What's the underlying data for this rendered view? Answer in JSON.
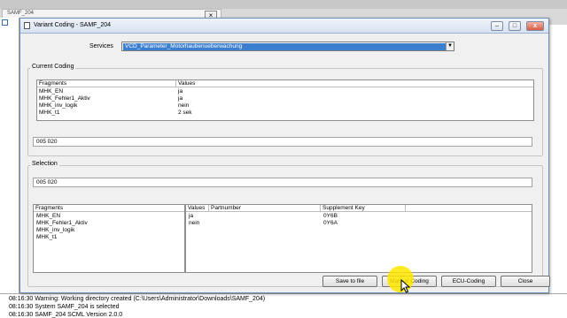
{
  "background": {
    "tab_label": "SAMF_204",
    "log_lines": [
      "08:16:30 Warning: Working directory created (C:\\Users\\Administrator\\Downloads\\SAMF_204)",
      "08:16:30 System SAMF_204 is selected",
      "08:16:30 SAMF_204 SCML Version 2.0.0"
    ]
  },
  "dialog": {
    "title": "Variant Coding - SAMF_204",
    "services": {
      "label": "Services",
      "value": "VCD_Parameter_Motorhaubenueberwachung"
    },
    "current_coding": {
      "label": "Current Coding",
      "headers": [
        "Fragments",
        "Values"
      ],
      "rows": [
        {
          "fragment": "MHK_EN",
          "value": "ja"
        },
        {
          "fragment": "MHK_Fehler1_Aktiv",
          "value": "ja"
        },
        {
          "fragment": "MHK_inv_logik",
          "value": "nein"
        },
        {
          "fragment": "MHK_t1",
          "value": "2 sek"
        }
      ],
      "coding_string": "005 020"
    },
    "selection": {
      "label": "Selection",
      "coding_string": "005 020",
      "fragments_header": "Fragments",
      "fragments": [
        "MHK_EN",
        "MHK_Fehler1_Aktiv",
        "MHK_inv_logik",
        "MHK_t1"
      ],
      "value_headers": [
        "Values",
        "Partnumber",
        "Supplement Key"
      ],
      "value_rows": [
        {
          "value": "ja",
          "partnumber": "",
          "supplement": "0Y6B"
        },
        {
          "value": "nein",
          "partnumber": "",
          "supplement": "0Y6A"
        }
      ]
    },
    "buttons": {
      "save": "Save to file",
      "manual": "Manual Coding",
      "ecu": "ECU-Coding",
      "close": "Close"
    },
    "window_controls": {
      "minimize": "–",
      "maximize": "□",
      "close": "x"
    },
    "accent_color": "#3c7fd0",
    "highlight_color": "#ffe600"
  }
}
